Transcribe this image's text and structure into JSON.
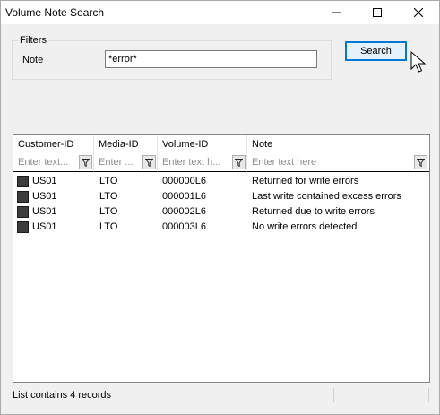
{
  "window": {
    "title": "Volume Note Search"
  },
  "titlebar_icons": [
    "minimize-icon",
    "maximize-icon",
    "close-icon"
  ],
  "filters": {
    "legend": "Filters",
    "note_label": "Note",
    "note_value": "*error*"
  },
  "search_button": "Search",
  "table": {
    "columns": [
      "Customer-ID",
      "Media-ID",
      "Volume-ID",
      "Note"
    ],
    "filter_placeholders": [
      "Enter text...",
      "Enter ...",
      "Enter text h...",
      "Enter text here"
    ],
    "rows": [
      {
        "customer": "US01",
        "media": "LTO",
        "volume": "000000L6",
        "note": "Returned for write errors"
      },
      {
        "customer": "US01",
        "media": "LTO",
        "volume": "000001L6",
        "note": "Last write contained excess errors"
      },
      {
        "customer": "US01",
        "media": "LTO",
        "volume": "000002L6",
        "note": "Returned due to write errors"
      },
      {
        "customer": "US01",
        "media": "LTO",
        "volume": "000003L6",
        "note": "No write errors detected"
      }
    ]
  },
  "status": {
    "text": "List contains 4 records"
  }
}
